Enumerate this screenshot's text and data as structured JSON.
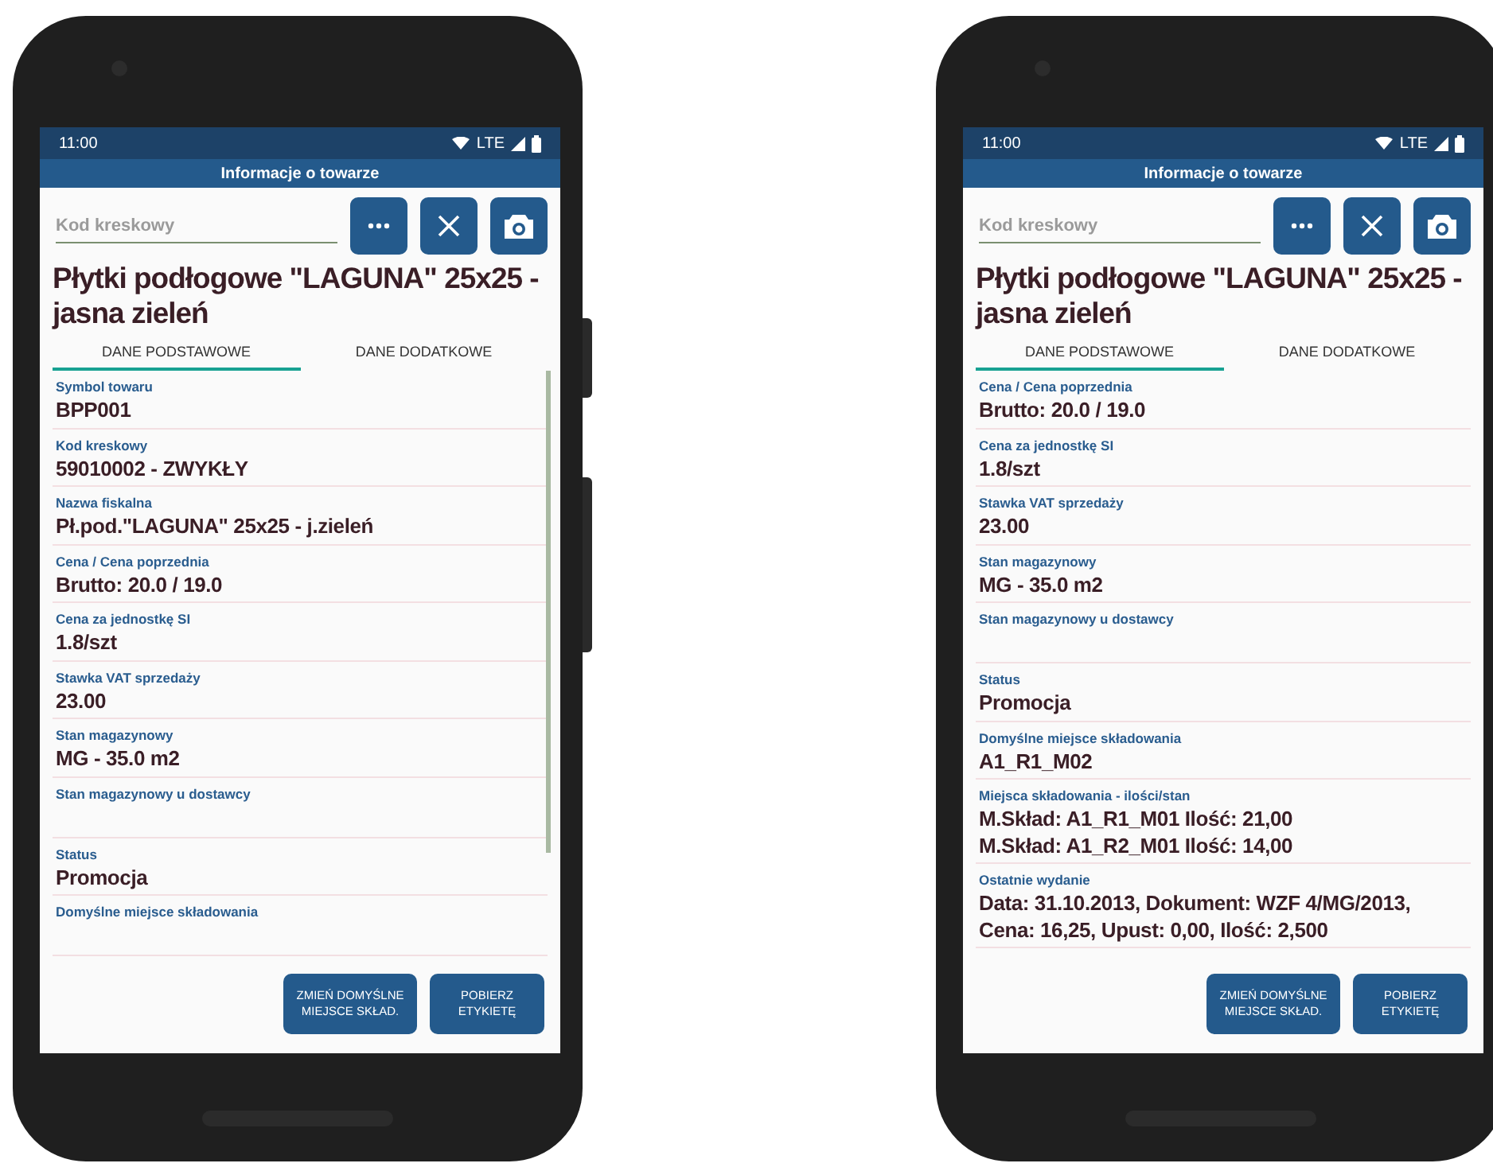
{
  "phones": [
    {
      "status": {
        "time": "11:00",
        "network": "LTE"
      },
      "app_title": "Informacje o towarze",
      "barcode": {
        "placeholder": "Kod kreskowy"
      },
      "product_title": "Płytki podłogowe \"LAGUNA\" 25x25 - jasna zieleń",
      "scrollbar": true,
      "tabs": [
        {
          "label": "DANE PODSTAWOWE",
          "selected": true
        },
        {
          "label": "DANE DODATKOWE",
          "selected": false
        }
      ],
      "fields": [
        {
          "label": "Symbol towaru",
          "values": [
            "BPP001"
          ]
        },
        {
          "label": "Kod kreskowy",
          "values": [
            "59010002 - ZWYKŁY"
          ]
        },
        {
          "label": "Nazwa fiskalna",
          "values": [
            "Pł.pod.\"LAGUNA\" 25x25 - j.zieleń"
          ]
        },
        {
          "label": "Cena / Cena poprzednia",
          "values": [
            "Brutto: 20.0 / 19.0"
          ]
        },
        {
          "label": "Cena za jednostkę SI",
          "values": [
            "1.8/szt"
          ]
        },
        {
          "label": "Stawka VAT sprzedaży",
          "values": [
            "23.00"
          ]
        },
        {
          "label": "Stan magazynowy",
          "values": [
            "MG - 35.0 m2"
          ]
        },
        {
          "label": "Stan magazynowy u dostawcy"
        },
        {
          "label": "Status",
          "values": [
            "Promocja"
          ]
        },
        {
          "label": "Domyślne miejsce składowania"
        }
      ],
      "buttons": [
        "ZMIEŃ DOMYŚLNE MIEJSCE SKŁAD.",
        "POBIERZ ETYKIETĘ"
      ]
    },
    {
      "status": {
        "time": "11:00",
        "network": "LTE"
      },
      "app_title": "Informacje o towarze",
      "barcode": {
        "placeholder": "Kod kreskowy"
      },
      "product_title": "Płytki podłogowe \"LAGUNA\" 25x25 - jasna zieleń",
      "scrollbar": false,
      "tabs": [
        {
          "label": "DANE PODSTAWOWE",
          "selected": true
        },
        {
          "label": "DANE DODATKOWE",
          "selected": false
        }
      ],
      "fields": [
        {
          "label": "Cena / Cena poprzednia",
          "values": [
            "Brutto: 20.0 / 19.0"
          ]
        },
        {
          "label": "Cena za jednostkę SI",
          "values": [
            "1.8/szt"
          ]
        },
        {
          "label": "Stawka VAT sprzedaży",
          "values": [
            "23.00"
          ]
        },
        {
          "label": "Stan magazynowy",
          "values": [
            "MG - 35.0 m2"
          ]
        },
        {
          "label": "Stan magazynowy u dostawcy"
        },
        {
          "label": "Status",
          "values": [
            "Promocja"
          ]
        },
        {
          "label": "Domyślne miejsce składowania",
          "values": [
            "A1_R1_M02"
          ]
        },
        {
          "label": "Miejsca składowania - ilości/stan",
          "values": [
            "M.Skład: A1_R1_M01 Ilość: 21,00",
            "M.Skład: A1_R2_M01 Ilość: 14,00"
          ]
        },
        {
          "label": "Ostatnie wydanie",
          "values": [
            "Data: 31.10.2013, Dokument: WZF 4/MG/2013, Cena: 16,25, Upust: 0,00, Ilość: 2,500"
          ]
        }
      ],
      "buttons": [
        "ZMIEŃ DOMYŚLNE MIEJSCE SKŁAD.",
        "POBIERZ ETYKIETĘ"
      ]
    }
  ]
}
